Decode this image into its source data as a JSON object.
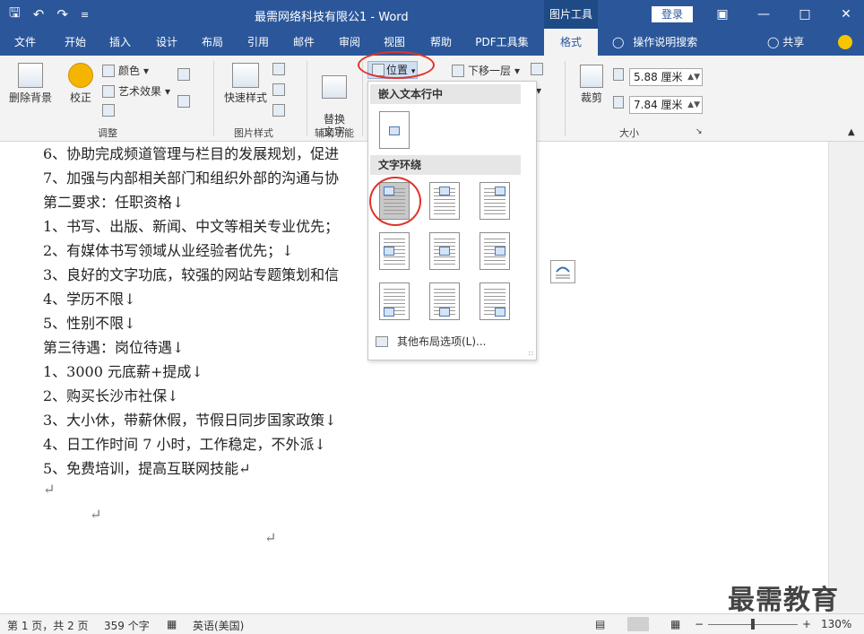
{
  "window": {
    "title": "最需网络科技有限公1  -  Word",
    "context_tools": "图片工具",
    "login": "登录",
    "qat_icons": [
      "save-icon",
      "undo-icon",
      "redo-icon",
      "customize-qat-icon"
    ],
    "controls": [
      "ribbon-display-icon",
      "minimize-icon",
      "maximize-icon",
      "close-icon"
    ]
  },
  "tabs": [
    "文件",
    "开始",
    "插入",
    "设计",
    "布局",
    "引用",
    "邮件",
    "审阅",
    "视图",
    "帮助",
    "PDF工具集",
    "格式"
  ],
  "active_tab": "格式",
  "tell_me": "操作说明搜索",
  "share": "共享",
  "ribbon": {
    "remove_bg": "删除背景",
    "corrections": "校正",
    "color": "颜色",
    "artistic": "艺术效果",
    "adjust_label": "调整",
    "quick_styles": "快速样式",
    "pic_styles_label": "图片样式",
    "alt_text": "替换\n文字",
    "accessibility_label": "辅助功能",
    "position": "位置",
    "send_backward": "下移一层",
    "crop": "裁剪",
    "height_value": "5.88 厘米",
    "width_value": "7.84 厘米",
    "size_label": "大小"
  },
  "dropdown": {
    "inline_header": "嵌入文本行中",
    "wrap_header": "文字环绕",
    "more_options": "其他布局选项(L)..."
  },
  "document": {
    "lines": [
      "6、协助完成频道管理与栏目的发展规划，促进",
      "7、加强与内部相关部门和组织外部的沟通与协",
      "第二要求：任职资格↓",
      "1、书写、出版、新闻、中文等相关专业优先；",
      "2、有媒体书写领域从业经验者优先；↓",
      "3、良好的文字功底，较强的网站专题策划和信",
      "4、学历不限↓",
      "5、性别不限↓",
      "第三待遇：岗位待遇↓",
      "1、3000 元底薪+提成↓",
      "2、购买长沙市社保↓",
      "3、大小休，带薪休假，节假日同步国家政策↓",
      "4、日工作时间 7 小时，工作稳定，不外派↓",
      "5、免费培训，提高互联网技能↵"
    ],
    "empty_marks": [
      "↵",
      "↵",
      "↵"
    ]
  },
  "status": {
    "page": "第 1 页，共 2 页",
    "words": "359 个字",
    "language": "英语(美国)",
    "zoom": "130%",
    "zoom_fraction": 0.5
  },
  "watermark": "最需教育",
  "colors": {
    "word_blue": "#2b579a",
    "highlight_red": "#e0322b"
  }
}
